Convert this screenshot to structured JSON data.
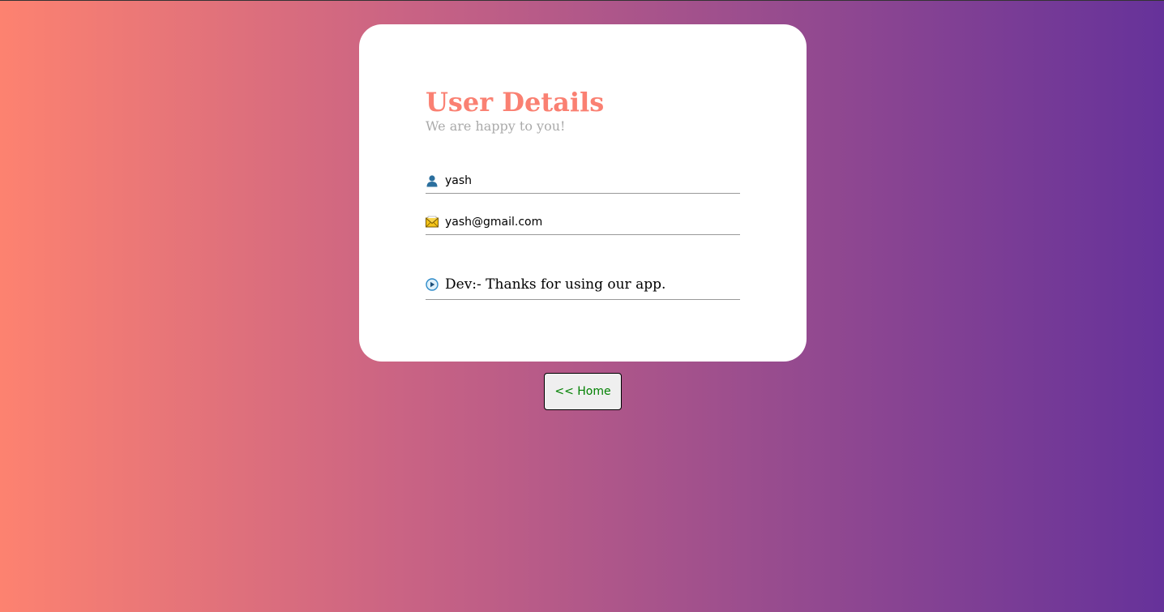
{
  "card": {
    "title": "User Details",
    "subtitle": "We are happy to you!"
  },
  "fields": {
    "name": {
      "icon": "user-icon",
      "value": "yash"
    },
    "email": {
      "icon": "envelope-icon",
      "value": "yash@gmail.com"
    },
    "message": {
      "icon": "play-circle-icon",
      "value": "Dev:- Thanks for using our app."
    }
  },
  "home_button": {
    "label": "<< Home"
  },
  "colors": {
    "title": "#fa8072",
    "subtitle": "#aaaaaa",
    "button_text": "#008000",
    "gradient_start": "#fd8270",
    "gradient_end": "#66329a"
  }
}
